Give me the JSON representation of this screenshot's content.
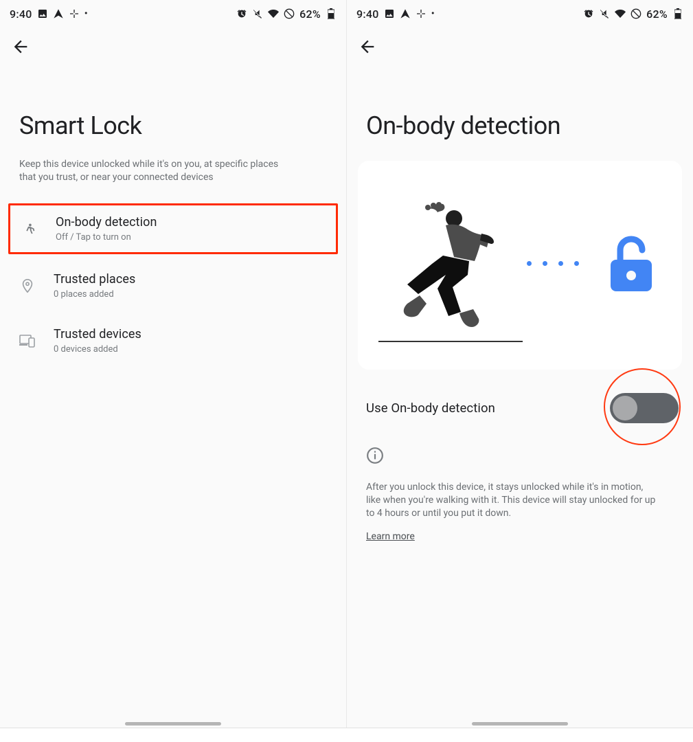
{
  "status": {
    "time": "9:40",
    "battery_pct": "62%"
  },
  "left_screen": {
    "title": "Smart Lock",
    "subtitle": "Keep this device unlocked while it's on you, at specific places that you trust, or near your connected devices",
    "items": [
      {
        "title": "On-body detection",
        "sub": "Off / Tap to turn on"
      },
      {
        "title": "Trusted places",
        "sub": "0 places added"
      },
      {
        "title": "Trusted devices",
        "sub": "0 devices added"
      }
    ]
  },
  "right_screen": {
    "title": "On-body detection",
    "toggle_label": "Use On-body detection",
    "toggle_state": "off",
    "description": "After you unlock this device, it stays unlocked while it's in motion, like when you're walking with it. This device will stay unlocked for up to 4 hours or until you put it down.",
    "learn_more": "Learn more"
  },
  "colors": {
    "highlight": "#ff2a00",
    "accent_blue": "#4285f4"
  }
}
